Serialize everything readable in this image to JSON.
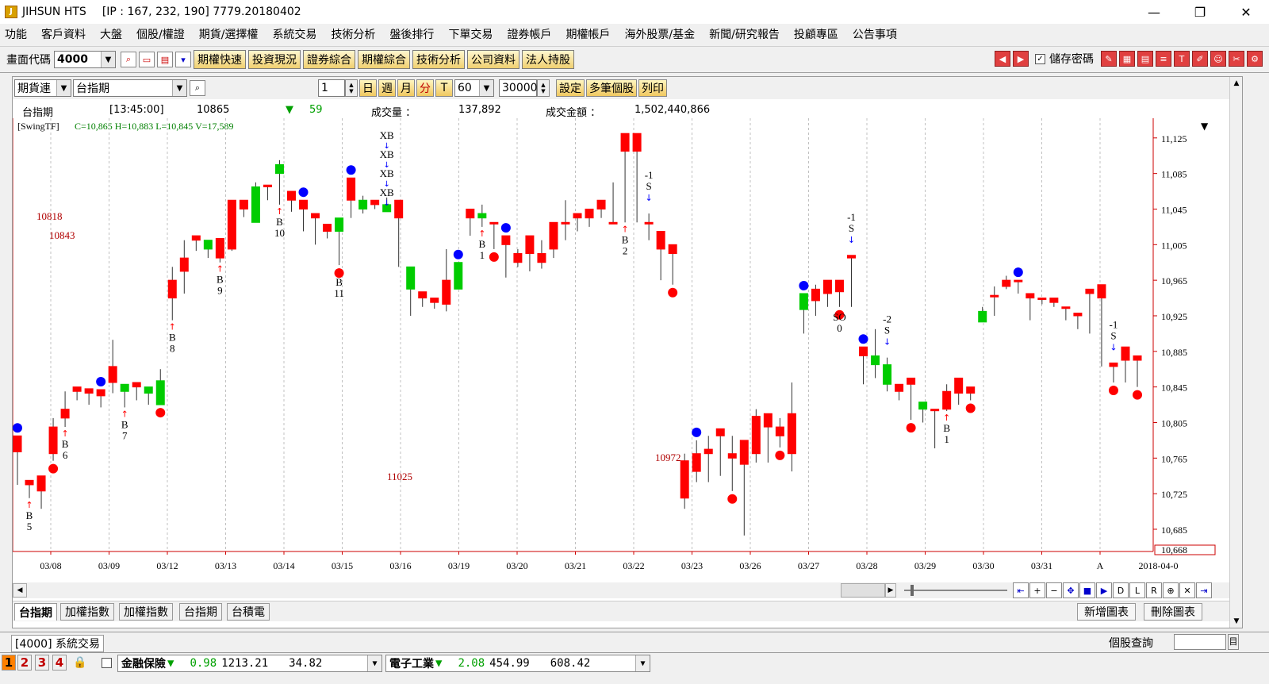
{
  "window": {
    "title": "JIHSUN HTS",
    "ip_info": "[IP : 167, 232, 190] 7779.20180402",
    "min_label": "—",
    "max_label": "❐",
    "close_label": "✕"
  },
  "menu": [
    "功能",
    "客戶資料",
    "大盤",
    "個股/權證",
    "期貨/選擇權",
    "系統交易",
    "技術分析",
    "盤後排行",
    "下單交易",
    "證券帳戶",
    "期權帳戶",
    "海外股票/基金",
    "新聞/研究報告",
    "投顧專區",
    "公告事項"
  ],
  "toolbar": {
    "code_label": "畫面代碼",
    "code_value": "4000",
    "buttons": [
      "期權快速",
      "投資現況",
      "證券綜合",
      "期權綜合",
      "技術分析",
      "公司資料",
      "法人持股"
    ],
    "save_pw_label": "儲存密碼"
  },
  "chart_controls": {
    "type_value": "期貨連",
    "symbol_value": "台指期",
    "count_value": "1",
    "periods": [
      "日",
      "週",
      "月",
      "分",
      "T"
    ],
    "minute_value": "60",
    "bars_value": "30000",
    "buttons": [
      "設定",
      "多筆個股",
      "列印"
    ]
  },
  "quote": {
    "name": "台指期",
    "time": "[13:45:00]",
    "price": "10865",
    "change_arrow": "▼",
    "change": "59",
    "volume_label": "成交量 ：",
    "volume": "137,892",
    "amount_label": "成交金額 ：",
    "amount": "1,502,440,866"
  },
  "indicator_line": {
    "name": "[SwingTF]",
    "values": "C=10,865 H=10,883 L=10,845 V=17,589"
  },
  "chart_data": {
    "type": "candlestick",
    "ylim": [
      10660,
      11140
    ],
    "yticks": [
      11125,
      11085,
      11045,
      11005,
      10965,
      10925,
      10885,
      10845,
      10805,
      10765,
      10725,
      10685
    ],
    "ytick_labels": [
      "11,125",
      "11,085",
      "11,045",
      "11,005",
      "10,965",
      "10,925",
      "10,885",
      "10,845",
      "10,805",
      "10,765",
      "10,725",
      "10,685"
    ],
    "last_price_label": "10,668",
    "date_labels": [
      "03/08",
      "03/09",
      "03/12",
      "03/13",
      "03/14",
      "03/15",
      "03/16",
      "03/19",
      "03/20",
      "03/21",
      "03/22",
      "03/23",
      "03/26",
      "03/27",
      "03/28",
      "03/29",
      "03/30",
      "03/31",
      "A",
      "2018-04-0"
    ],
    "candles": [
      [
        10772,
        10790,
        10735,
        10735
      ],
      [
        10735,
        10740,
        10720,
        10728
      ],
      [
        10728,
        10745,
        10708,
        10710
      ],
      [
        10770,
        10800,
        10762,
        10810
      ],
      [
        10810,
        10820,
        10800,
        10840
      ],
      [
        10840,
        10845,
        10830,
        10838
      ],
      [
        10838,
        10843,
        10825,
        10838
      ],
      [
        10835,
        10842,
        10822,
        10828
      ],
      [
        10850,
        10868,
        10838,
        10898
      ],
      [
        10848,
        10840,
        10822,
        10845
      ],
      [
        10845,
        10850,
        10830,
        10838
      ],
      [
        10845,
        10838,
        10825,
        10830
      ],
      [
        10852,
        10825,
        10825,
        10865
      ],
      [
        10945,
        10965,
        10920,
        10980
      ],
      [
        10975,
        10990,
        10950,
        11010
      ],
      [
        11010,
        11015,
        10998,
        11003
      ],
      [
        11010,
        11000,
        10995,
        10990
      ],
      [
        10990,
        11012,
        10985,
        11010
      ],
      [
        11000,
        11055,
        10998,
        11045
      ],
      [
        11045,
        11055,
        11036,
        11045
      ],
      [
        11070,
        11030,
        11030,
        11075
      ],
      [
        11070,
        11072,
        11060,
        11055
      ],
      [
        11095,
        11085,
        11050,
        11100
      ],
      [
        11055,
        11065,
        11048,
        11042
      ],
      [
        11045,
        11055,
        11020,
        11035
      ],
      [
        11035,
        11040,
        11005,
        11020
      ],
      [
        11020,
        11028,
        11012,
        11020
      ],
      [
        11035,
        11020,
        10982,
        10990
      ],
      [
        11055,
        11080,
        11040,
        11035
      ],
      [
        11055,
        11045,
        11040,
        11060
      ],
      [
        11050,
        11055,
        11045,
        11050
      ],
      [
        11050,
        11042,
        11042,
        11058
      ],
      [
        11035,
        11055,
        11025,
        10980
      ],
      [
        10980,
        10955,
        10925,
        10950
      ],
      [
        10945,
        10952,
        10942,
        10935
      ],
      [
        10940,
        10945,
        10933,
        10945
      ],
      [
        10938,
        10965,
        10930,
        11000
      ],
      [
        10985,
        10955,
        10955,
        10965
      ],
      [
        11035,
        11045,
        11020,
        11015
      ],
      [
        11040,
        11035,
        11025,
        11050
      ],
      [
        11030,
        11030,
        11010,
        11000
      ],
      [
        11005,
        11015,
        10980,
        10968
      ],
      [
        10985,
        10995,
        10980,
        11000
      ],
      [
        10995,
        11015,
        10975,
        10985
      ],
      [
        10985,
        10995,
        10978,
        11010
      ],
      [
        11000,
        11030,
        10990,
        11015
      ],
      [
        11030,
        11030,
        11010,
        11055
      ],
      [
        11035,
        11040,
        11020,
        11035
      ],
      [
        11035,
        11045,
        11025,
        11035
      ],
      [
        11045,
        11055,
        11035,
        11045
      ],
      [
        11030,
        11030,
        11030,
        11075
      ],
      [
        11110,
        11130,
        11030,
        11125
      ],
      [
        11110,
        11130,
        11030,
        11030
      ],
      [
        11030,
        11030,
        11010,
        11040
      ],
      [
        11000,
        11020,
        10965,
        10975
      ],
      [
        10995,
        11005,
        10960,
        10990
      ],
      [
        10720,
        10762,
        10708,
        10770
      ],
      [
        10750,
        10770,
        10738,
        10785
      ],
      [
        10770,
        10775,
        10738,
        10790
      ],
      [
        10790,
        10798,
        10745,
        10765
      ],
      [
        10765,
        10770,
        10728,
        10790
      ],
      [
        10758,
        10785,
        10678,
        10720
      ],
      [
        10770,
        10812,
        10760,
        10820
      ],
      [
        10800,
        10815,
        10760,
        10790
      ],
      [
        10790,
        10800,
        10777,
        10810
      ],
      [
        10770,
        10815,
        10750,
        10850
      ],
      [
        10950,
        10932,
        10905,
        10945
      ],
      [
        10942,
        10955,
        10925,
        10960
      ],
      [
        10950,
        10965,
        10935,
        10965
      ],
      [
        10952,
        10965,
        10935,
        10962
      ],
      [
        10990,
        10993,
        10935,
        10945
      ],
      [
        10880,
        10890,
        10848,
        10860
      ],
      [
        10880,
        10870,
        10855,
        10910
      ],
      [
        10870,
        10848,
        10840,
        10878
      ],
      [
        10840,
        10848,
        10830,
        10838
      ],
      [
        10848,
        10855,
        10808,
        10818
      ],
      [
        10828,
        10820,
        10805,
        10818
      ],
      [
        10820,
        10820,
        10776,
        10818
      ],
      [
        10820,
        10840,
        10818,
        10848
      ],
      [
        10838,
        10855,
        10825,
        10838
      ],
      [
        10838,
        10845,
        10830,
        10838
      ],
      [
        10930,
        10918,
        10918,
        10935
      ],
      [
        10948,
        10948,
        10925,
        10958
      ],
      [
        10958,
        10965,
        10955,
        10970
      ],
      [
        10965,
        10965,
        10950,
        10955
      ],
      [
        10945,
        10950,
        10920,
        10948
      ],
      [
        10945,
        10945,
        10940,
        10938
      ],
      [
        10940,
        10945,
        10935,
        10935
      ],
      [
        10935,
        10935,
        10920,
        10925
      ],
      [
        10925,
        10928,
        10910,
        10915
      ],
      [
        10950,
        10955,
        10905,
        10913
      ],
      [
        10945,
        10960,
        10868,
        10870
      ],
      [
        10868,
        10872,
        10850,
        10872
      ],
      [
        10875,
        10890,
        10850,
        10872
      ],
      [
        10875,
        10880,
        10845,
        10865
      ]
    ],
    "buy_labels": [
      [
        "B",
        "5"
      ],
      [
        "B",
        "6"
      ],
      [
        "B",
        "7"
      ],
      [
        "B",
        "8"
      ],
      [
        "B",
        "9"
      ],
      [
        "B",
        "10"
      ],
      [
        "B",
        "11"
      ],
      [
        "B",
        "1"
      ],
      [
        "B",
        "2"
      ],
      [
        "B",
        "1"
      ]
    ],
    "sell_labels": [
      [
        "-1",
        "S"
      ],
      [
        "-1",
        "S"
      ],
      [
        "-2",
        "S"
      ],
      [
        "-1",
        "S"
      ]
    ],
    "xb_labels": [
      "XB",
      "XB",
      "XB",
      "XB"
    ],
    "so_label": [
      "SO",
      "0"
    ],
    "annotations": [
      "10818",
      "10843",
      "11025",
      "10972"
    ]
  },
  "bottom_tabs": [
    "台指期",
    "加權指數",
    "加權指數",
    "台指期",
    "台積電"
  ],
  "right_buttons": [
    "新增圖表",
    "刪除圖表"
  ],
  "status": {
    "window_tab": "[4000] 系統交易",
    "stock_query_label": "個股查詢",
    "page_nums": [
      "1",
      "2",
      "3",
      "4"
    ]
  },
  "ticker": [
    {
      "name": "金融保險",
      "arrow": "▼",
      "change": "0.98",
      "value": "1213.21",
      "vol": "34.82"
    },
    {
      "name": "電子工業",
      "arrow": "▼",
      "change": "2.08",
      "value": "454.99",
      "vol": "608.42"
    }
  ],
  "colors": {
    "up": "#ff0000",
    "down": "#00cc00",
    "grid": "#bbbbbb",
    "axis": "#cc0000",
    "signal_blue": "#0000ff"
  }
}
